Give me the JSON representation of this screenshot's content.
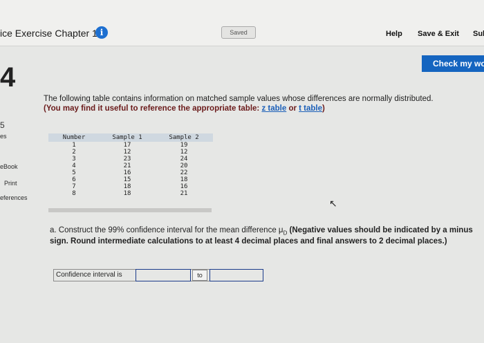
{
  "header": {
    "title": "ice Exercise Chapter 10",
    "saved_label": "Saved",
    "help_label": "Help",
    "save_exit_label": "Save & Exit",
    "submit_label": "Sul"
  },
  "check_button_label": "Check my wo",
  "question_number": "4",
  "sidebar": {
    "number": "5",
    "letters": "es",
    "ebook_label": "eBook",
    "print_label": "Print",
    "references_label": "eferences"
  },
  "intro": {
    "text": "The following table contains information on matched sample values whose differences are normally distributed.",
    "hint_prefix": "(You may find it useful to reference the appropriate table: ",
    "z_link": "z table",
    "or_text": " or ",
    "t_link": "t table",
    "hint_suffix": ")"
  },
  "table": {
    "headers": [
      "Number",
      "Sample 1",
      "Sample 2"
    ],
    "rows": [
      [
        "1",
        "17",
        "19"
      ],
      [
        "2",
        "12",
        "12"
      ],
      [
        "3",
        "23",
        "24"
      ],
      [
        "4",
        "21",
        "20"
      ],
      [
        "5",
        "16",
        "22"
      ],
      [
        "6",
        "15",
        "18"
      ],
      [
        "7",
        "18",
        "16"
      ],
      [
        "8",
        "18",
        "21"
      ]
    ]
  },
  "part_a": {
    "prefix": "a. Construct the 99% confidence interval for the mean difference μ",
    "subscript": "D",
    "bold_text": " (Negative values should be indicated by a minus sign. Round intermediate calculations to at least 4 decimal places and final answers to 2 decimal places.)"
  },
  "ci": {
    "label": "Confidence interval is",
    "to_label": "to",
    "lower_value": "",
    "upper_value": ""
  }
}
